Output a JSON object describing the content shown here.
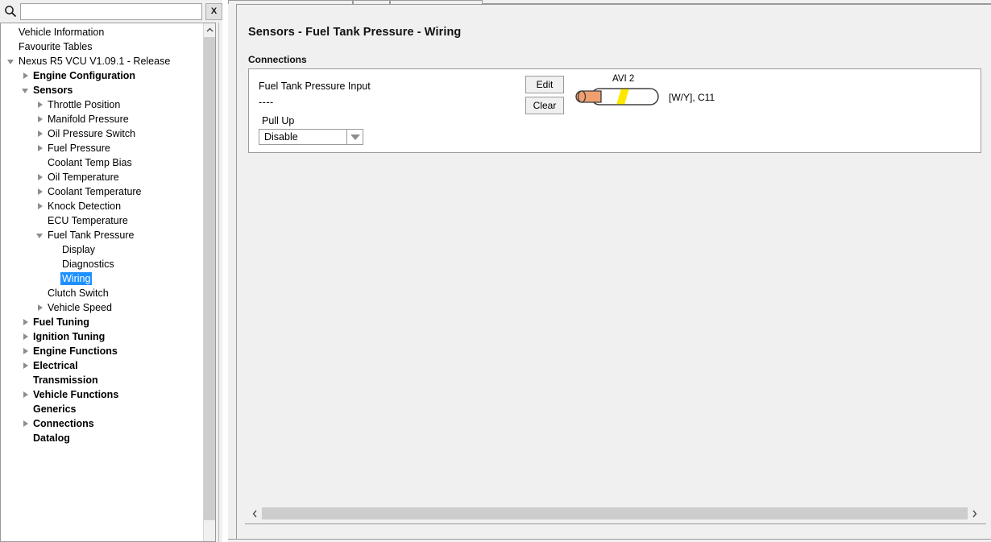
{
  "search": {
    "placeholder": "",
    "value": "",
    "icon": "search-icon",
    "clear_label": "X"
  },
  "tree": {
    "items": [
      {
        "label": "Vehicle Information",
        "depth": 0,
        "twisty": "none",
        "bold": false,
        "selected": false
      },
      {
        "label": "Favourite Tables",
        "depth": 0,
        "twisty": "none",
        "bold": false,
        "selected": false
      },
      {
        "label": "Nexus R5 VCU V1.09.1 - Release",
        "depth": 0,
        "twisty": "down",
        "bold": false,
        "selected": false
      },
      {
        "label": "Engine Configuration",
        "depth": 1,
        "twisty": "right",
        "bold": true,
        "selected": false
      },
      {
        "label": "Sensors",
        "depth": 1,
        "twisty": "down",
        "bold": true,
        "selected": false
      },
      {
        "label": "Throttle Position",
        "depth": 2,
        "twisty": "right",
        "bold": false,
        "selected": false
      },
      {
        "label": "Manifold Pressure",
        "depth": 2,
        "twisty": "right",
        "bold": false,
        "selected": false
      },
      {
        "label": "Oil Pressure Switch",
        "depth": 2,
        "twisty": "right",
        "bold": false,
        "selected": false
      },
      {
        "label": "Fuel Pressure",
        "depth": 2,
        "twisty": "right",
        "bold": false,
        "selected": false
      },
      {
        "label": "Coolant Temp Bias",
        "depth": 2,
        "twisty": "none",
        "bold": false,
        "selected": false
      },
      {
        "label": "Oil Temperature",
        "depth": 2,
        "twisty": "right",
        "bold": false,
        "selected": false
      },
      {
        "label": "Coolant Temperature",
        "depth": 2,
        "twisty": "right",
        "bold": false,
        "selected": false
      },
      {
        "label": "Knock Detection",
        "depth": 2,
        "twisty": "right",
        "bold": false,
        "selected": false
      },
      {
        "label": "ECU Temperature",
        "depth": 2,
        "twisty": "none",
        "bold": false,
        "selected": false
      },
      {
        "label": "Fuel Tank Pressure",
        "depth": 2,
        "twisty": "down",
        "bold": false,
        "selected": false
      },
      {
        "label": "Display",
        "depth": 3,
        "twisty": "none",
        "bold": false,
        "selected": false
      },
      {
        "label": "Diagnostics",
        "depth": 3,
        "twisty": "none",
        "bold": false,
        "selected": false
      },
      {
        "label": "Wiring",
        "depth": 3,
        "twisty": "none",
        "bold": false,
        "selected": true
      },
      {
        "label": "Clutch Switch",
        "depth": 2,
        "twisty": "none",
        "bold": false,
        "selected": false
      },
      {
        "label": "Vehicle Speed",
        "depth": 2,
        "twisty": "right",
        "bold": false,
        "selected": false
      },
      {
        "label": "Fuel Tuning",
        "depth": 1,
        "twisty": "right",
        "bold": true,
        "selected": false
      },
      {
        "label": "Ignition Tuning",
        "depth": 1,
        "twisty": "right",
        "bold": true,
        "selected": false
      },
      {
        "label": "Engine Functions",
        "depth": 1,
        "twisty": "right",
        "bold": true,
        "selected": false
      },
      {
        "label": "Electrical",
        "depth": 1,
        "twisty": "right",
        "bold": true,
        "selected": false
      },
      {
        "label": "Transmission",
        "depth": 1,
        "twisty": "none",
        "bold": true,
        "selected": false
      },
      {
        "label": "Vehicle Functions",
        "depth": 1,
        "twisty": "right",
        "bold": true,
        "selected": false
      },
      {
        "label": "Generics",
        "depth": 1,
        "twisty": "none",
        "bold": true,
        "selected": false
      },
      {
        "label": "Connections",
        "depth": 1,
        "twisty": "right",
        "bold": true,
        "selected": false
      },
      {
        "label": "Datalog",
        "depth": 1,
        "twisty": "none",
        "bold": true,
        "selected": false
      }
    ]
  },
  "main": {
    "title": "Sensors - Fuel Tank Pressure - Wiring",
    "section_label": "Connections",
    "connection": {
      "name": "Fuel Tank Pressure Input",
      "sub_value": "----",
      "pullup_label": "Pull Up",
      "pullup_value": "Disable",
      "edit_label": "Edit",
      "clear_label": "Clear",
      "pin_label": "AVI 2",
      "wire_code": "[W/Y], C11",
      "wire_terminal_color": "#F0A070",
      "wire_sheath_color": "#FFFFFF",
      "wire_stripe_color": "#FFE800"
    }
  },
  "colors": {
    "selection_blue": "#1E90FF",
    "panel_gray": "#F0F0F0",
    "border_gray": "#9A9A9A",
    "scroll_thumb": "#CDCDCD"
  }
}
